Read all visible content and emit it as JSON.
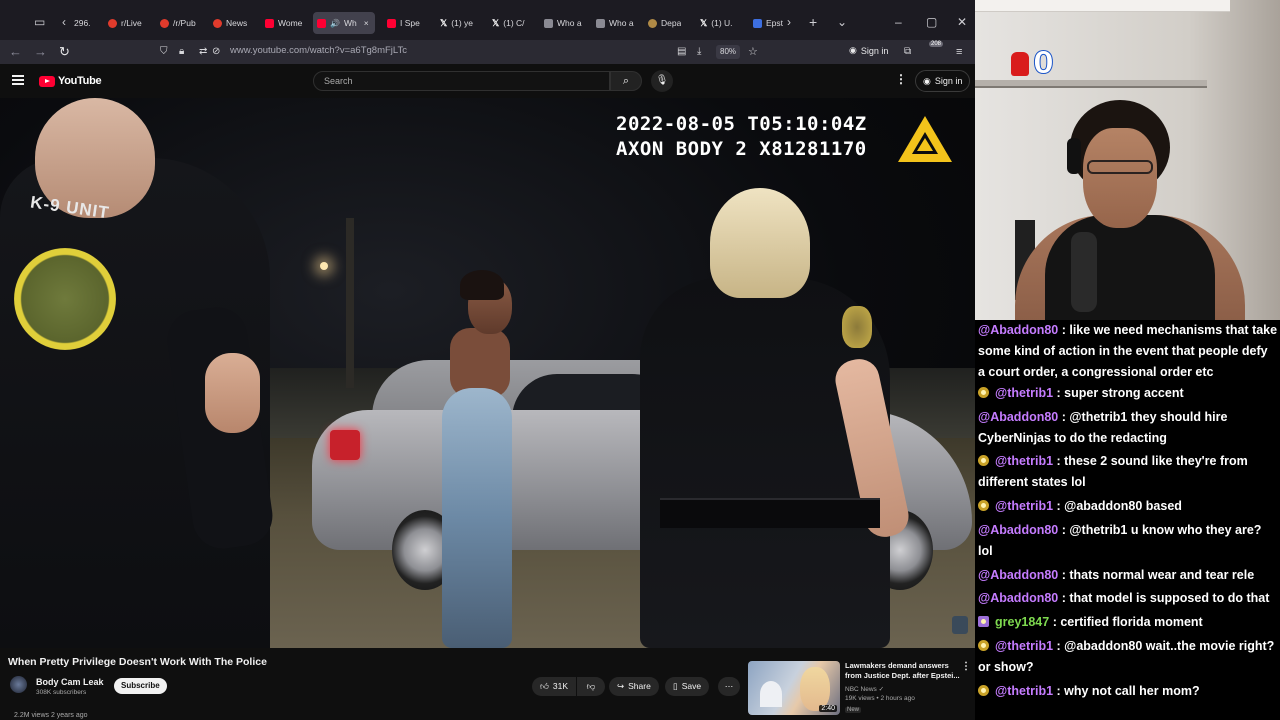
{
  "browser": {
    "tabs": [
      {
        "label": "296.",
        "icon": "grey"
      },
      {
        "label": "r/Live",
        "icon": "red"
      },
      {
        "label": "/r/Pub",
        "icon": "red"
      },
      {
        "label": "News",
        "icon": "red"
      },
      {
        "label": "Wome",
        "icon": "yt"
      },
      {
        "label": "Wh",
        "icon": "yt"
      },
      {
        "label": "I Spe",
        "icon": "yt"
      },
      {
        "label": "(1) ye",
        "icon": "x"
      },
      {
        "label": "(1) C/",
        "icon": "x"
      },
      {
        "label": "Who a",
        "icon": "grey"
      },
      {
        "label": "Who a",
        "icon": "grey"
      },
      {
        "label": "Depa",
        "icon": "seal"
      },
      {
        "label": "(1) U.",
        "icon": "x"
      },
      {
        "label": "Epst",
        "icon": "blue"
      }
    ],
    "url": "www.youtube.com/watch?v=a6Tg8mFjLTc",
    "zoom": "80%",
    "signin_label": "Sign in",
    "badge_count": "208"
  },
  "youtube": {
    "logo_text": "YouTube",
    "search_placeholder": "Search",
    "signin_label": "Sign in",
    "video": {
      "timestamp": "2022-08-05 T05:10:04Z",
      "camera_id": "AXON BODY 2 X81281170",
      "patch_text": "K-9 UNIT"
    },
    "title": "When Pretty Privilege Doesn't Work With The Police",
    "channel": {
      "name": "Body Cam Leak",
      "subscribers": "308K subscribers",
      "subscribe_label": "Subscribe"
    },
    "views_line": "2.2M views  2 years ago",
    "actions": {
      "likes": "31K",
      "share": "Share",
      "save": "Save"
    },
    "recommended": {
      "title": "Lawmakers demand answers from Justice Dept. after Epstei...",
      "channel": "NBC News",
      "meta": "19K views • 2 hours ago",
      "badge": "New",
      "duration": "2:40"
    }
  },
  "stream": {
    "overlay_number": "0"
  },
  "chat": [
    {
      "user": "@Abaddon80",
      "badge": "none",
      "color": "purple",
      "text": " : like we need mechanisms that take some kind of action in the event that people defy a court order, a congressional order etc"
    },
    {
      "user": "@thetrib1",
      "badge": "circle",
      "color": "purple",
      "text": " : super strong accent"
    },
    {
      "user": "@Abaddon80",
      "badge": "none",
      "color": "purple",
      "text": " : @thetrib1 they should hire CyberNinjas to do the redacting"
    },
    {
      "user": "@thetrib1",
      "badge": "circle",
      "color": "purple",
      "text": " : these 2 sound like they're from different states lol"
    },
    {
      "user": "@thetrib1",
      "badge": "circle",
      "color": "purple",
      "text": " : @abaddon80 based"
    },
    {
      "user": "@Abaddon80",
      "badge": "none",
      "color": "purple",
      "text": " : @thetrib1 u know who they are? lol"
    },
    {
      "user": "@Abaddon80",
      "badge": "none",
      "color": "purple",
      "text": " : thats normal wear and tear rele"
    },
    {
      "user": "@Abaddon80",
      "badge": "none",
      "color": "purple",
      "text": " : that model is supposed to do that"
    },
    {
      "user": "grey1847",
      "badge": "square",
      "color": "green",
      "text": " : certified florida moment"
    },
    {
      "user": "@thetrib1",
      "badge": "circle",
      "color": "purple",
      "text": " : @abaddon80 wait..the movie right? or show?"
    },
    {
      "user": "@thetrib1",
      "badge": "circle",
      "color": "purple",
      "text": " : why not call her mom?"
    }
  ],
  "colors": {
    "chat_user": "#c57cff",
    "chat_user_alt": "#7ed94f",
    "yt_red": "#ff0033",
    "browser_bg": "#1c1b22"
  }
}
